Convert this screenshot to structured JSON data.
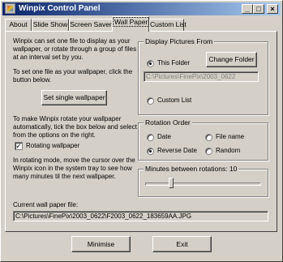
{
  "window": {
    "title": "Winpix Control Panel",
    "controls": [
      "_",
      "□",
      "×"
    ]
  },
  "tabs": [
    "About",
    "Slide Show",
    "Screen Saver",
    "Wall Paper",
    "Custom List"
  ],
  "active_tab": "Wall Paper",
  "intro": {
    "line1": "Winpix can set one file to display as your",
    "line2": "wallpaper, or rotate through a group of files",
    "line3": "at an interval set by you."
  },
  "single": {
    "line1": "To set one file as your wallpaper, click the",
    "line2": "button below.",
    "button": "Set single wallpaper"
  },
  "rotate": {
    "line1": "To make Winpix rotate your wallpaper",
    "line2": "automatically, tick the box below and select",
    "line3": "from the options on the right.",
    "checkbox_label": "Rotating wallpaper",
    "checked": true
  },
  "rotation_help": {
    "line1": "In rotating mode, move the cursor over the",
    "line2": "Winpix icon in the system tray to see how",
    "line3": "many minutes til the next wallpaper."
  },
  "display_from": {
    "title": "Display Pictures From",
    "this_folder": "This Folder",
    "change_folder": "Change Folder",
    "folder_path": "C:\\Pictures\\FinePix\\2003_0622",
    "custom_list": "Custom List",
    "selected": "This Folder"
  },
  "rotation_order": {
    "title": "Rotation Order",
    "date": "Date",
    "file_name": "File name",
    "reverse_date": "Reverse Date",
    "random": "Random",
    "selected": "Reverse Date"
  },
  "minutes": {
    "label": "Minutes between rotations: 10",
    "value": 10
  },
  "current_file": {
    "label": "Current wall paper file:",
    "path": "C:\\Pictures\\FinePix\\2003_0622\\F2003_0622_183659AA.JPG"
  },
  "footer": {
    "minimise": "Minimise",
    "exit": "Exit"
  }
}
